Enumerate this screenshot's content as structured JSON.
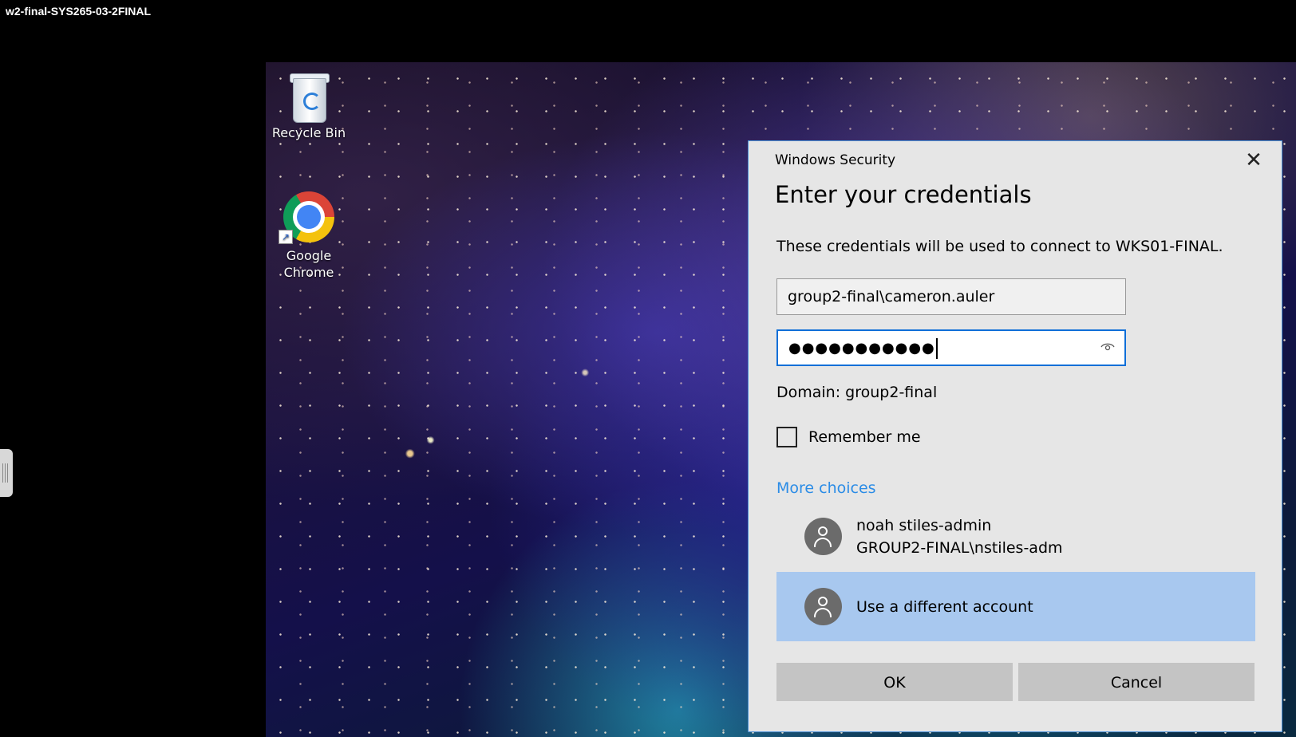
{
  "session": {
    "title": "w2-final-SYS265-03-2FINAL"
  },
  "desktop": {
    "icons": [
      {
        "label": "Recycle Bin",
        "icon": "recycle-bin-icon"
      },
      {
        "label": "Google\nChrome",
        "icon": "chrome-icon"
      }
    ]
  },
  "dialog": {
    "caption": "Windows Security",
    "close_glyph": "✕",
    "title": "Enter your credentials",
    "description": "These credentials will be used to connect to WKS01-FINAL.",
    "username_value": "group2-final\\cameron.auler",
    "password_mask": "●●●●●●●●●●●",
    "domain_text": "Domain: group2-final",
    "remember_label": "Remember me",
    "remember_checked": false,
    "more_choices": "More choices",
    "accounts": [
      {
        "name": "noah stiles-admin",
        "id": "GROUP2-FINAL\\nstiles-adm"
      },
      {
        "name": "Use a different account",
        "selected": true
      }
    ],
    "ok_label": "OK",
    "cancel_label": "Cancel"
  },
  "colors": {
    "accent": "#0f6fd8",
    "link": "#2b8ce6",
    "selected_account_bg": "#a8c8ef",
    "dialog_bg": "#e6e6e6"
  }
}
